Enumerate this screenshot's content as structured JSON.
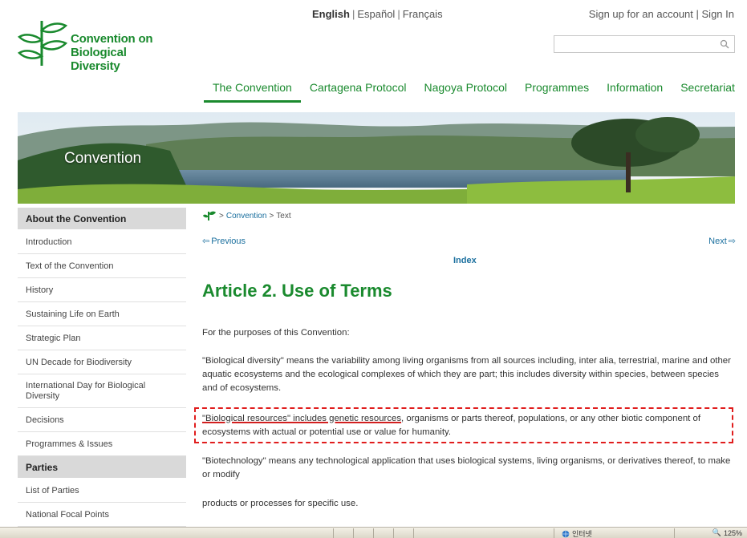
{
  "header": {
    "logo_line1": "Convention on",
    "logo_line2": "Biological Diversity",
    "languages": [
      "English",
      "Español",
      "Français"
    ],
    "account": {
      "signup": "Sign up for an account",
      "signin": "Sign In"
    },
    "search": {
      "value": "",
      "placeholder": ""
    }
  },
  "nav": [
    {
      "label": "The Convention",
      "active": true
    },
    {
      "label": "Cartagena Protocol"
    },
    {
      "label": "Nagoya Protocol"
    },
    {
      "label": "Programmes"
    },
    {
      "label": "Information"
    },
    {
      "label": "Secretariat"
    }
  ],
  "banner": {
    "title": "Convention"
  },
  "sidebar": {
    "head1": "About the Convention",
    "items1": [
      "Introduction",
      "Text of the Convention",
      "History",
      "Sustaining Life on Earth",
      "Strategic Plan",
      "UN Decade for Biodiversity",
      "International Day for Biological Diversity",
      "Decisions",
      "Programmes & Issues"
    ],
    "head2": "Parties",
    "items2": [
      "List of Parties",
      "National Focal Points"
    ]
  },
  "content": {
    "breadcrumb": {
      "link": "Convention",
      "current": "Text"
    },
    "prev": "Previous",
    "next": "Next",
    "index": "Index",
    "title": "Article 2. Use of Terms",
    "p1": "For the purposes of this Convention:",
    "p2": "\"Biological diversity\" means the variability among living organisms from all sources including, inter alia, terrestrial, marine and other aquatic ecosystems and the ecological complexes of which they are part; this includes diversity within species, between species and of ecosystems.",
    "p3_underlined": "\"Biological resources\" includes genetic resources",
    "p3_rest": ", organisms or parts thereof, populations, or any other biotic component of ecosystems with actual or potential use or value for humanity.",
    "p4": "\"Biotechnology\" means any technological application that uses biological systems, living organisms, or derivatives thereof, to make or modify",
    "p5": "products or processes for specific use."
  },
  "statusbar": {
    "zone": "인터넷",
    "zoom": "125%"
  },
  "colors": {
    "brand_green": "#1a8a2e",
    "link_blue": "#1a6f9e",
    "highlight_red": "#e01d1d"
  }
}
